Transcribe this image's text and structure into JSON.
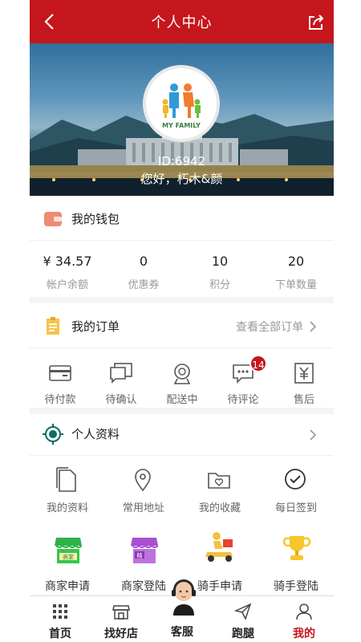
{
  "header": {
    "title": "个人中心"
  },
  "profile": {
    "id": "ID:6942",
    "greeting": "您好，朽木&颜",
    "logo_text": "MY FAMILY"
  },
  "wallet": {
    "title": "我的钱包",
    "items": [
      {
        "value": "¥ 34.57",
        "label": "帐户余额"
      },
      {
        "value": "0",
        "label": "优惠券"
      },
      {
        "value": "10",
        "label": "积分"
      },
      {
        "value": "20",
        "label": "下单数量"
      }
    ]
  },
  "orders": {
    "title": "我的订单",
    "view_all": "查看全部订单",
    "items": [
      {
        "label": "待付款",
        "icon": "card-icon"
      },
      {
        "label": "待确认",
        "icon": "chat-cards-icon"
      },
      {
        "label": "配送中",
        "icon": "delivery-icon"
      },
      {
        "label": "待评论",
        "icon": "comment-icon",
        "badge": "14"
      },
      {
        "label": "售后",
        "icon": "yen-receipt-icon"
      }
    ]
  },
  "profile_section": {
    "title": "个人资料",
    "items": [
      {
        "label": "我的资料",
        "icon": "document-icon"
      },
      {
        "label": "常用地址",
        "icon": "location-icon"
      },
      {
        "label": "我的收藏",
        "icon": "favorite-folder-icon"
      },
      {
        "label": "每日签到",
        "icon": "check-circle-icon"
      }
    ],
    "apply_items": [
      {
        "label": "商家申请",
        "icon": "shop-green-icon",
        "tag": "商家"
      },
      {
        "label": "商家登陆",
        "icon": "shop-purple-icon",
        "tag": "精"
      },
      {
        "label": "骑手申请",
        "icon": "scooter-rider-icon"
      },
      {
        "label": "骑手登陆",
        "icon": "trophy-icon"
      }
    ]
  },
  "tabs": [
    {
      "label": "首页",
      "icon": "grid-icon"
    },
    {
      "label": "找好店",
      "icon": "store-icon"
    },
    {
      "label": "客服",
      "icon": "customer-service-avatar"
    },
    {
      "label": "跑腿",
      "icon": "paper-plane-icon"
    },
    {
      "label": "我的",
      "icon": "user-icon",
      "active": true
    }
  ],
  "colors": {
    "brand": "#c5161d",
    "accent_green": "#0f6b63",
    "badge": "#c5161d"
  }
}
